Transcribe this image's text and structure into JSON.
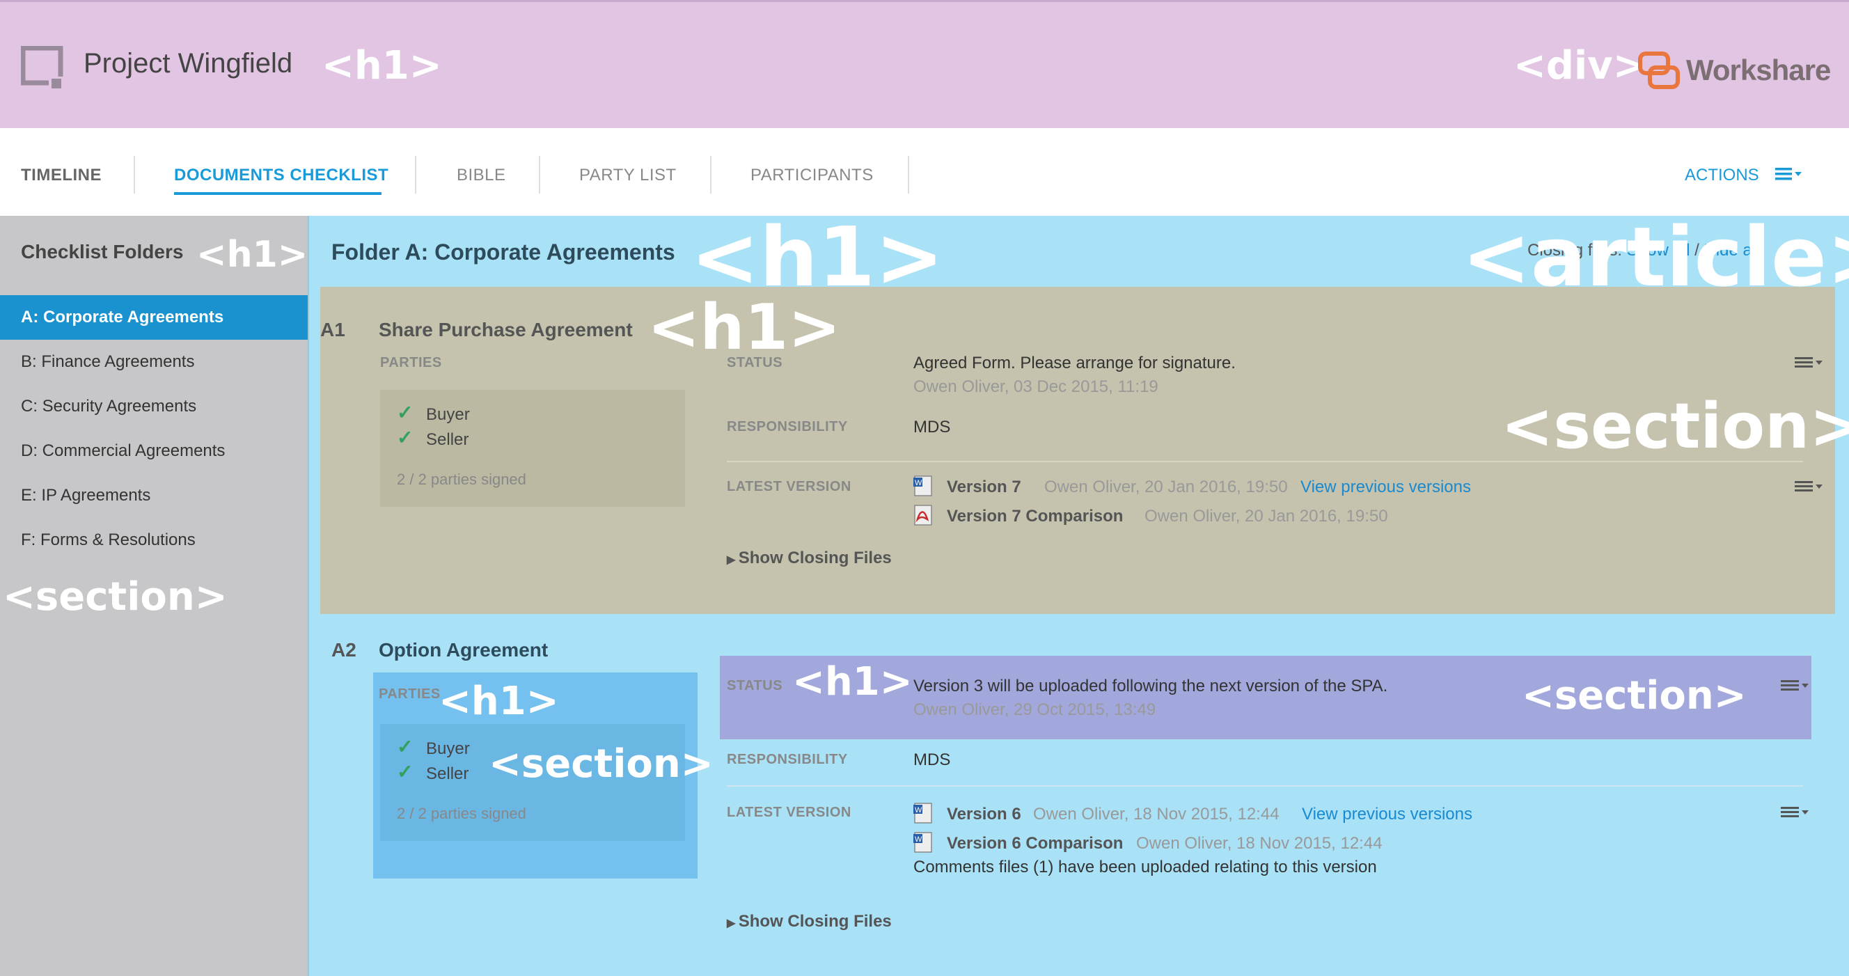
{
  "header": {
    "project_title": "Project Wingfield",
    "title_tag": "<h1>",
    "logo_tag": "<div>",
    "brand": "Workshare"
  },
  "nav": {
    "tabs": [
      "TIMELINE",
      "DOCUMENTS CHECKLIST",
      "BIBLE",
      "PARTY LIST",
      "PARTICIPANTS"
    ],
    "actions": "ACTIONS"
  },
  "sidebar": {
    "title": "Checklist Folders",
    "title_tag": "<h1>",
    "section_tag": "<section>",
    "items": [
      "A: Corporate Agreements",
      "B: Finance Agreements",
      "C: Security Agreements",
      "D: Commercial Agreements",
      "E: IP Agreements",
      "F: Forms & Resolutions"
    ]
  },
  "main": {
    "folder_title": "Folder A: Corporate Agreements",
    "folder_title_tag": "<h1>",
    "article_tag": "<article>",
    "closing_files_label": "Closing files:",
    "closing_show_all": "Show all",
    "closing_hide_all": "Hide all",
    "labels": {
      "parties": "PARTIES",
      "status": "STATUS",
      "responsibility": "RESPONSIBILITY",
      "latest_version": "LATEST VERSION"
    },
    "show_closing_files": "Show Closing Files",
    "items": [
      {
        "num": "A1",
        "title": "Share Purchase Agreement",
        "title_tag": "<h1>",
        "section_tag": "<section>",
        "parties": [
          "Buyer",
          "Seller"
        ],
        "signed": "2 / 2 parties signed",
        "status": "Agreed Form. Please arrange for signature.",
        "status_meta": "Owen Oliver, 03 Dec 2015, 11:19",
        "responsibility": "MDS",
        "versions": [
          {
            "name": "Version 7",
            "meta": "Owen Oliver, 20 Jan 2016, 19:50",
            "link": "View previous versions",
            "icon": "word-file-icon"
          },
          {
            "name": "Version 7 Comparison",
            "meta": "Owen Oliver, 20 Jan 2016, 19:50",
            "icon": "pdf-file-icon"
          }
        ]
      },
      {
        "num": "A2",
        "title": "Option Agreement",
        "parties_tag": "<h1>",
        "parties_section_tag": "<section>",
        "status_tag": "<h1>",
        "status_section_tag": "<section>",
        "parties": [
          "Buyer",
          "Seller"
        ],
        "signed": "2 / 2 parties signed",
        "status": "Version 3 will be uploaded following the next version of the SPA.",
        "status_meta": "Owen Oliver, 29 Oct 2015, 13:49",
        "responsibility": "MDS",
        "versions": [
          {
            "name": "Version 6",
            "meta": "Owen Oliver, 18 Nov 2015, 12:44",
            "link": "View previous versions",
            "icon": "word-file-icon"
          },
          {
            "name": "Version 6 Comparison",
            "meta": "Owen Oliver, 18 Nov 2015, 12:44",
            "icon": "word-file-icon"
          }
        ],
        "comments_note": "Comments files (1) have been uploaded relating to this version"
      }
    ]
  },
  "colors": {
    "accent": "#1a9ad8",
    "header_bg": "#e1c5e2",
    "main_bg": "#a9e1f7",
    "section_bg": "#c5c3ad",
    "overlay_blue": "#74c0ee",
    "overlay_purple": "#a2a8dc"
  }
}
